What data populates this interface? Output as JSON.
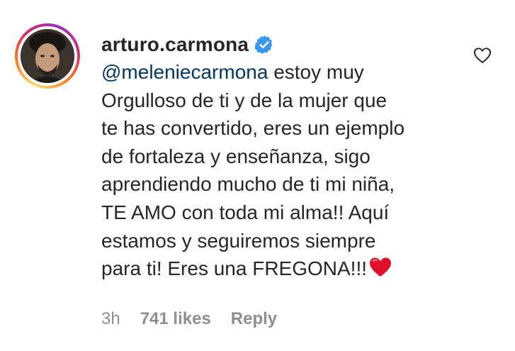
{
  "comment": {
    "username": "arturo.carmona",
    "mention": "@meleniecarmona",
    "lines": [
      " estoy muy",
      "Orgulloso de ti y de la mujer que",
      "te has convertido, eres un ejemplo",
      "de fortaleza y enseñanza, sigo",
      "aprendiendo mucho de ti mi niña,",
      "TE AMO con toda mi alma!! Aquí",
      "estamos y seguiremos siempre",
      "para ti! Eres una FREGONA!!!"
    ],
    "emoji": "red-heart-emoji",
    "verified_icon": "verified-badge-icon",
    "like_icon": "heart-outline-icon"
  },
  "meta": {
    "time": "3h",
    "likes": "741 likes",
    "reply": "Reply"
  },
  "colors": {
    "text": "#262626",
    "mention": "#00376b",
    "muted": "#8e8e8e",
    "verified": "#3897f0",
    "heart": "#e0102b"
  }
}
